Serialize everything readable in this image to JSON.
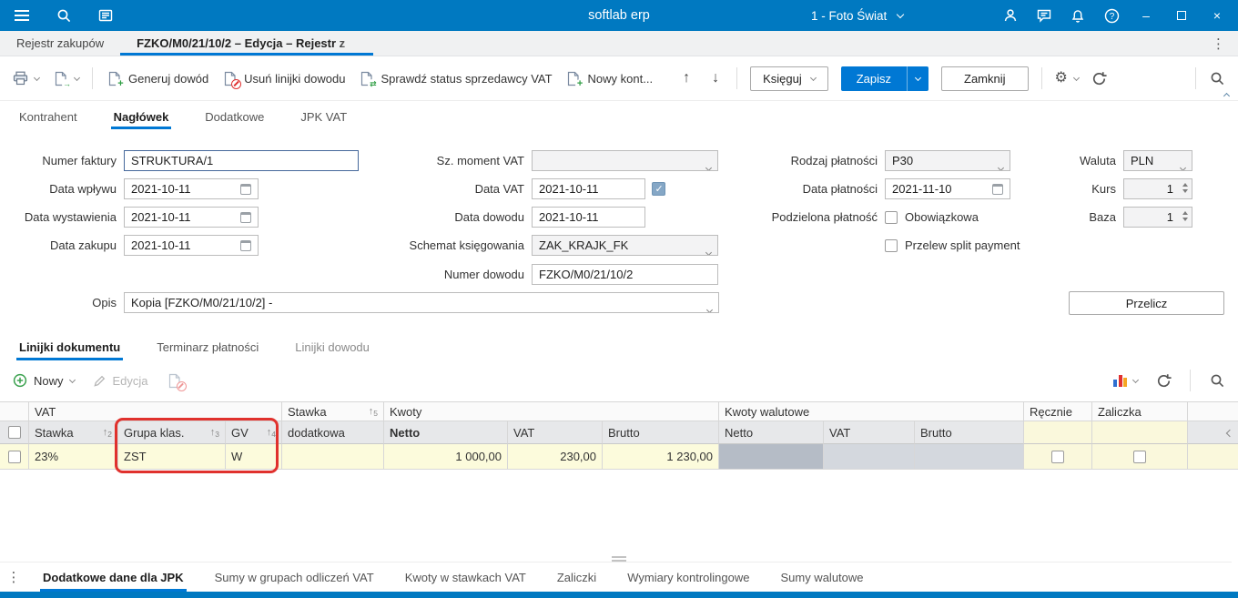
{
  "colors": {
    "brand": "#0079c1",
    "accent": "#0078d4",
    "annotation": "#e0312d"
  },
  "icons": {
    "minimize": "–",
    "close": "×",
    "more_vertical": "⋮",
    "arrow_up": "↑",
    "arrow_down": "↓",
    "gear": "⚙"
  },
  "topbar": {
    "title": "softlab erp",
    "company": "1 - Foto Świat"
  },
  "window_tabs": [
    {
      "label": "Rejestr zakupów"
    },
    {
      "label": "FZKO/M0/21/10/2 – Edycja – Rejestr z"
    }
  ],
  "main_toolbar": {
    "generate_doc": "Generuj dowód",
    "delete_doc_lines": "Usuń linijki dowodu",
    "check_vat_status": "Sprawdź status sprzedawcy VAT",
    "new_contractor": "Nowy kont...",
    "post": "Księguj",
    "save": "Zapisz",
    "close": "Zamknij"
  },
  "header_tabs": [
    {
      "label": "Kontrahent"
    },
    {
      "label": "Nagłówek"
    },
    {
      "label": "Dodatkowe"
    },
    {
      "label": "JPK VAT"
    }
  ],
  "form": {
    "invoice_number_label": "Numer faktury",
    "invoice_number": "STRUKTURA/1",
    "receipt_date_label": "Data wpływu",
    "receipt_date": "2021-10-11",
    "issue_date_label": "Data wystawienia",
    "issue_date": "2021-10-11",
    "purchase_date_label": "Data zakupu",
    "purchase_date": "2021-10-11",
    "vat_moment_label": "Sz. moment VAT",
    "vat_moment": "",
    "vat_date_label": "Data VAT",
    "vat_date": "2021-10-11",
    "doc_date_label": "Data dowodu",
    "doc_date": "2021-10-11",
    "schema_label": "Schemat księgowania",
    "schema": "ZAK_KRAJK_FK",
    "doc_number_label": "Numer dowodu",
    "doc_number": "FZKO/M0/21/10/2",
    "payment_type_label": "Rodzaj płatności",
    "payment_type": "P30",
    "payment_date_label": "Data płatności",
    "payment_date": "2021-11-10",
    "split_label": "Podzielona płatność",
    "split_required": "Obowiązkowa",
    "split_transfer": "Przelew split payment",
    "currency_label": "Waluta",
    "currency": "PLN",
    "rate_label": "Kurs",
    "rate": "1",
    "base_label": "Baza",
    "base": "1",
    "description_label": "Opis",
    "description": "Kopia [FZKO/M0/21/10/2] -",
    "recalculate": "Przelicz"
  },
  "section_tabs": [
    {
      "label": "Linijki dokumentu"
    },
    {
      "label": "Terminarz płatności"
    },
    {
      "label": "Linijki dowodu"
    }
  ],
  "grid_toolbar": {
    "new": "Nowy",
    "edit": "Edycja"
  },
  "grid": {
    "group_vat": "VAT",
    "group_stawka": "Stawka",
    "col_dodatkowa": "dodatkowa",
    "group_kwoty": "Kwoty",
    "group_kwoty_walutowe": "Kwoty walutowe",
    "col_recznie": "Ręcznie",
    "col_zaliczka": "Zaliczka",
    "col_stawka": "Stawka",
    "col_grupa": "Grupa klas.",
    "col_gv": "GV",
    "col_netto": "Netto",
    "col_vat": "VAT",
    "col_brutto": "Brutto",
    "col_w_netto": "Netto",
    "col_w_vat": "VAT",
    "col_w_brutto": "Brutto",
    "sort_2": "2",
    "sort_3": "3",
    "sort_4": "4",
    "sort_5": "5",
    "rows": [
      {
        "stawka": "23%",
        "grupa": "ZST",
        "gv": "W",
        "stawka_dod": "",
        "netto": "1 000,00",
        "vat": "230,00",
        "brutto": "1 230,00",
        "w_netto": "",
        "w_vat": "",
        "w_brutto": ""
      }
    ]
  },
  "bottom_tabs": [
    {
      "label": "Dodatkowe dane dla JPK"
    },
    {
      "label": "Sumy w grupach odliczeń VAT"
    },
    {
      "label": "Kwoty w stawkach VAT"
    },
    {
      "label": "Zaliczki"
    },
    {
      "label": "Wymiary kontrolingowe"
    },
    {
      "label": "Sumy walutowe"
    }
  ]
}
